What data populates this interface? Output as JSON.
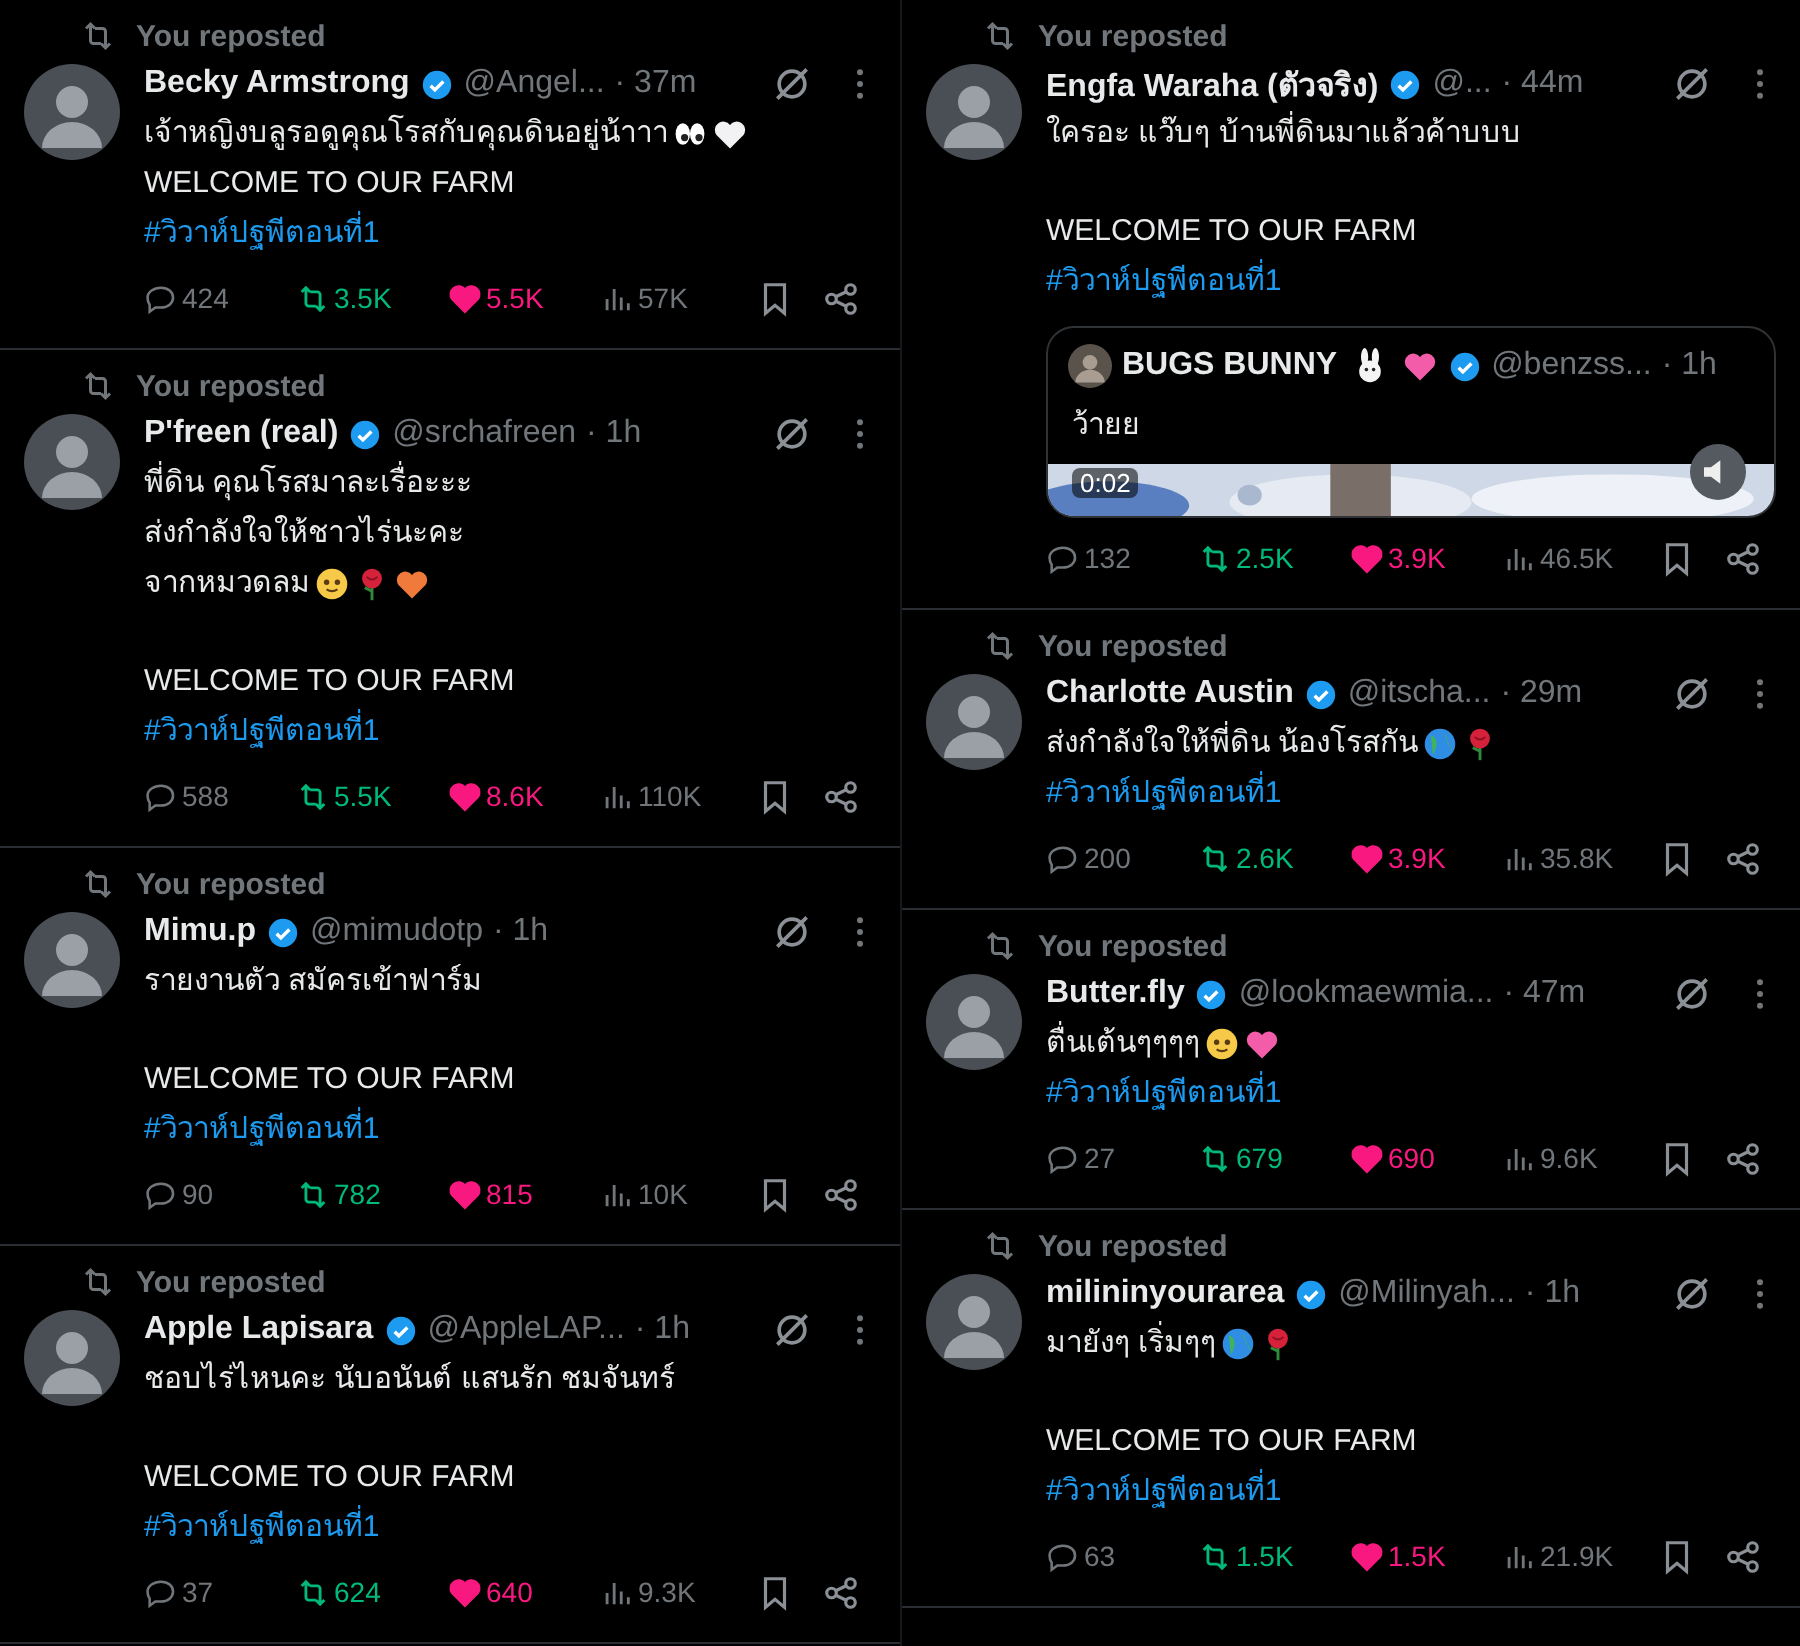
{
  "columns": [
    {
      "tweets": [
        {
          "repost_label": "You reposted",
          "name": "Becky Armstrong",
          "verified": true,
          "handle": "@Angel...",
          "time": "· 37m",
          "paragraphs": [
            {
              "lines": [
                {
                  "text": "เจ้าหญิงบลูรอดูคุณโรสกับคุณดินอยู่น้าาา",
                  "icons": [
                    {
                      "kind": "eyes"
                    },
                    {
                      "kind": "white_heart"
                    }
                  ]
                },
                {
                  "text": "WELCOME TO OUR FARM"
                }
              ]
            }
          ],
          "hashtag": "#วิวาห์ปฐพีตอนที่1",
          "replies": "424",
          "reposts": "3.5K",
          "reposted": true,
          "likes": "5.5K",
          "liked": true,
          "views": "57K"
        },
        {
          "repost_label": "You reposted",
          "name": "P'freen (real)",
          "verified": true,
          "handle": "@srchafreen",
          "time": "· 1h",
          "paragraphs": [
            {
              "lines": [
                {
                  "text": "พี่ดิน คุณโรสมาละเรื่อะะะ"
                },
                {
                  "text": "ส่งกำลังใจให้ชาวไร่นะคะ"
                },
                {
                  "text": "จากหมวดลม",
                  "icons": [
                    {
                      "kind": "smile"
                    },
                    {
                      "kind": "rose"
                    },
                    {
                      "kind": "orange_heart"
                    }
                  ]
                }
              ]
            },
            {
              "lines": [
                {
                  "text": "WELCOME TO OUR FARM"
                }
              ]
            }
          ],
          "hashtag": "#วิวาห์ปฐพีตอนที่1",
          "replies": "588",
          "reposts": "5.5K",
          "reposted": true,
          "likes": "8.6K",
          "liked": true,
          "views": "110K"
        },
        {
          "repost_label": "You reposted",
          "name": "Mimu.p",
          "verified": true,
          "handle": "@mimudotp",
          "time": "· 1h",
          "paragraphs": [
            {
              "lines": [
                {
                  "text": "รายงานตัว สมัครเข้าฟาร์ม"
                }
              ]
            },
            {
              "lines": [
                {
                  "text": "WELCOME TO OUR FARM"
                }
              ]
            }
          ],
          "hashtag": "#วิวาห์ปฐพีตอนที่1",
          "replies": "90",
          "reposts": "782",
          "reposted": true,
          "likes": "815",
          "liked": true,
          "views": "10K"
        },
        {
          "repost_label": "You reposted",
          "name": "Apple Lapisara",
          "verified": true,
          "handle": "@AppleLAP...",
          "time": "· 1h",
          "paragraphs": [
            {
              "lines": [
                {
                  "text": "ชอบไร่ไหนคะ นับอนันต์ แสนรัก ชมจันทร์"
                }
              ]
            },
            {
              "lines": [
                {
                  "text": "WELCOME TO OUR FARM"
                }
              ]
            }
          ],
          "hashtag": "#วิวาห์ปฐพีตอนที่1",
          "replies": "37",
          "reposts": "624",
          "reposted": true,
          "likes": "640",
          "liked": true,
          "views": "9.3K"
        }
      ]
    },
    {
      "tweets": [
        {
          "repost_label": "You reposted",
          "name": "Engfa Waraha (ตัวจริง)",
          "verified": true,
          "handle": "@...",
          "time": "· 44m",
          "paragraphs": [
            {
              "lines": [
                {
                  "text": "ใครอะ แว๊บๆ บ้านพี่ดินมาแล้วค้าบบบ"
                }
              ]
            },
            {
              "lines": [
                {
                  "text": "WELCOME TO OUR FARM"
                }
              ]
            }
          ],
          "hashtag": "#วิวาห์ปฐพีตอนที่1",
          "quote": {
            "name": "BUGS BUNNY",
            "icons": [
              {
                "kind": "rabbit"
              },
              {
                "kind": "pink_heart"
              }
            ],
            "verified": true,
            "handle": "@benzss...",
            "time": "· 1h",
            "text": "ว้ายย",
            "video_time": "0:02"
          },
          "replies": "132",
          "reposts": "2.5K",
          "reposted": true,
          "likes": "3.9K",
          "liked": true,
          "views": "46.5K"
        },
        {
          "repost_label": "You reposted",
          "name": "Charlotte Austin",
          "verified": true,
          "handle": "@itscha...",
          "time": "· 29m",
          "paragraphs": [
            {
              "lines": [
                {
                  "text": "ส่งกำลังใจให้พี่ดิน น้องโรสกัน",
                  "icons": [
                    {
                      "kind": "globe"
                    },
                    {
                      "kind": "rose"
                    }
                  ]
                }
              ]
            }
          ],
          "hashtag": "#วิวาห์ปฐพีตอนที่1",
          "replies": "200",
          "reposts": "2.6K",
          "reposted": true,
          "likes": "3.9K",
          "liked": true,
          "views": "35.8K"
        },
        {
          "repost_label": "You reposted",
          "name": "Butter.fly",
          "verified": true,
          "handle": "@lookmaewmia...",
          "time": "· 47m",
          "paragraphs": [
            {
              "lines": [
                {
                  "text": "ตื่นเต้นๆๆๆๆ",
                  "icons": [
                    {
                      "kind": "pleading"
                    },
                    {
                      "kind": "pink_heart"
                    }
                  ]
                }
              ]
            }
          ],
          "hashtag": "#วิวาห์ปฐพีตอนที่1",
          "replies": "27",
          "reposts": "679",
          "reposted": true,
          "likes": "690",
          "liked": true,
          "views": "9.6K"
        },
        {
          "repost_label": "You reposted",
          "name": "milininyourarea",
          "verified": true,
          "handle": "@Milinyah...",
          "time": "· 1h",
          "paragraphs": [
            {
              "lines": [
                {
                  "text": "มายังๆ เริ่มๆๆ",
                  "icons": [
                    {
                      "kind": "globe"
                    },
                    {
                      "kind": "rose"
                    }
                  ]
                }
              ]
            },
            {
              "lines": [
                {
                  "text": "WELCOME TO OUR FARM"
                }
              ]
            }
          ],
          "hashtag": "#วิวาห์ปฐพีตอนที่1",
          "replies": "63",
          "reposts": "1.5K",
          "reposted": true,
          "likes": "1.5K",
          "liked": true,
          "views": "21.9K"
        }
      ]
    }
  ]
}
